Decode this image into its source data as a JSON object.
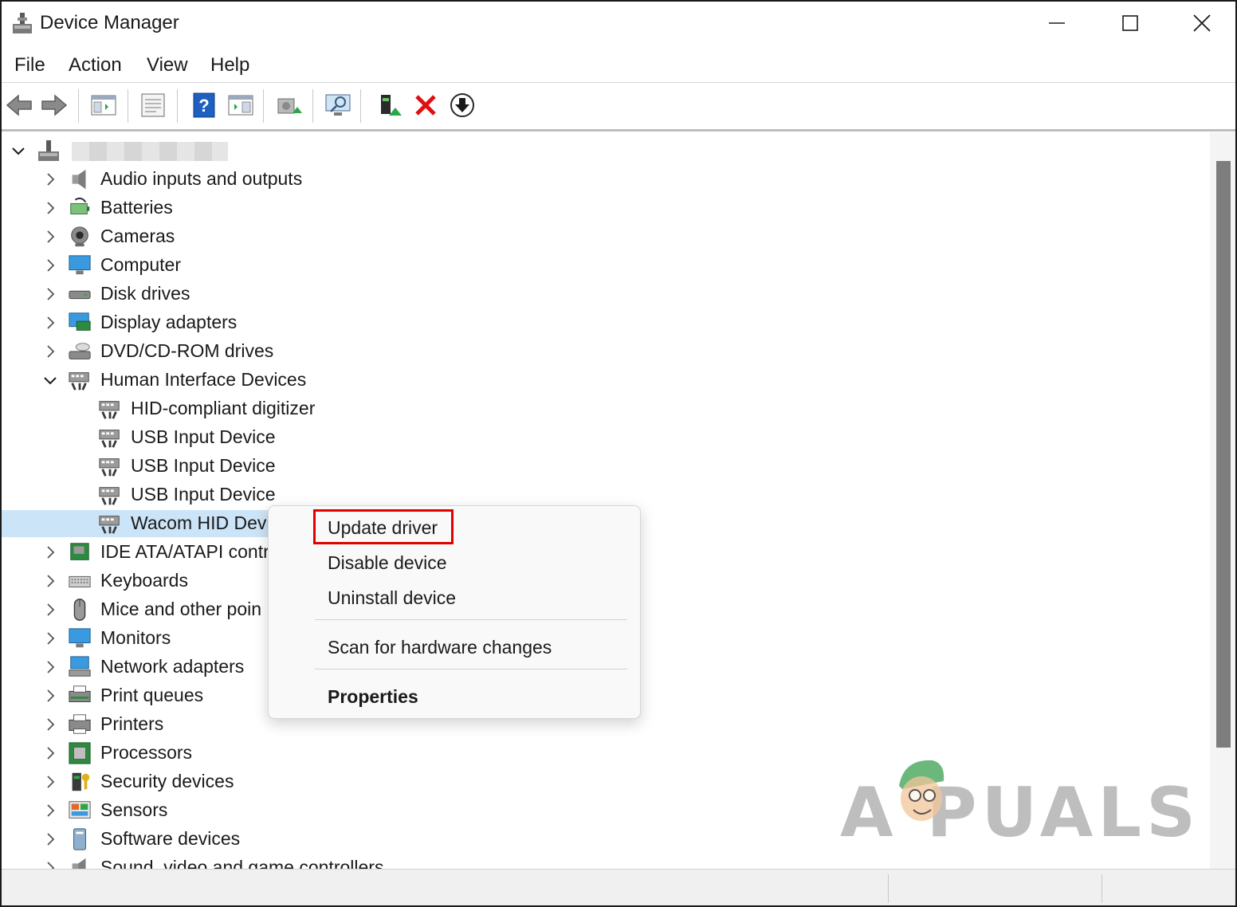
{
  "window": {
    "title": "Device Manager"
  },
  "menubar": {
    "items": [
      "File",
      "Action",
      "View",
      "Help"
    ]
  },
  "toolbar": {
    "buttons": [
      "back-arrow-icon",
      "forward-arrow-icon",
      "show-hide-console-tree-icon",
      "properties-sheet-icon",
      "help-icon",
      "action-pane-icon",
      "scan-hardware-icon",
      "monitor-icon",
      "update-driver-icon",
      "uninstall-x-icon",
      "disable-download-icon"
    ]
  },
  "tree": {
    "root_label_blurred": true,
    "categories": [
      {
        "label": "Audio inputs and outputs",
        "icon": "speaker-icon"
      },
      {
        "label": "Batteries",
        "icon": "battery-icon"
      },
      {
        "label": "Cameras",
        "icon": "camera-icon"
      },
      {
        "label": "Computer",
        "icon": "computer-icon"
      },
      {
        "label": "Disk drives",
        "icon": "disk-drive-icon"
      },
      {
        "label": "Display adapters",
        "icon": "display-adapter-icon"
      },
      {
        "label": "DVD/CD-ROM drives",
        "icon": "dvd-drive-icon"
      },
      {
        "label": "Human Interface Devices",
        "icon": "hid-icon",
        "expanded": true
      },
      {
        "label": "IDE ATA/ATAPI contro",
        "icon": "ide-controller-icon"
      },
      {
        "label": "Keyboards",
        "icon": "keyboard-icon"
      },
      {
        "label": "Mice and other poin",
        "icon": "mouse-icon"
      },
      {
        "label": "Monitors",
        "icon": "monitor-icon"
      },
      {
        "label": "Network adapters",
        "icon": "network-adapter-icon"
      },
      {
        "label": "Print queues",
        "icon": "print-queue-icon"
      },
      {
        "label": "Printers",
        "icon": "printer-icon"
      },
      {
        "label": "Processors",
        "icon": "processor-icon"
      },
      {
        "label": "Security devices",
        "icon": "security-device-icon"
      },
      {
        "label": "Sensors",
        "icon": "sensor-icon"
      },
      {
        "label": "Software devices",
        "icon": "software-device-icon"
      },
      {
        "label": "Sound, video and game controllers",
        "icon": "sound-controller-icon"
      }
    ],
    "hid_children": [
      {
        "label": "HID-compliant digitizer"
      },
      {
        "label": "USB Input Device"
      },
      {
        "label": "USB Input Device"
      },
      {
        "label": "USB Input Device"
      },
      {
        "label": "Wacom HID Devi",
        "selected": true
      }
    ]
  },
  "context_menu": {
    "items": [
      {
        "label": "Update driver",
        "highlighted": true
      },
      {
        "label": "Disable device"
      },
      {
        "label": "Uninstall device"
      },
      {
        "label": "Scan for hardware changes"
      },
      {
        "label": "Properties",
        "bold": true
      }
    ]
  },
  "watermark": {
    "text": "A  PUALS"
  },
  "colors": {
    "selection": "#cce4f7",
    "highlight_box": "#e00000",
    "uninstall_red": "#e01010",
    "help_blue": "#1f5fbf"
  }
}
